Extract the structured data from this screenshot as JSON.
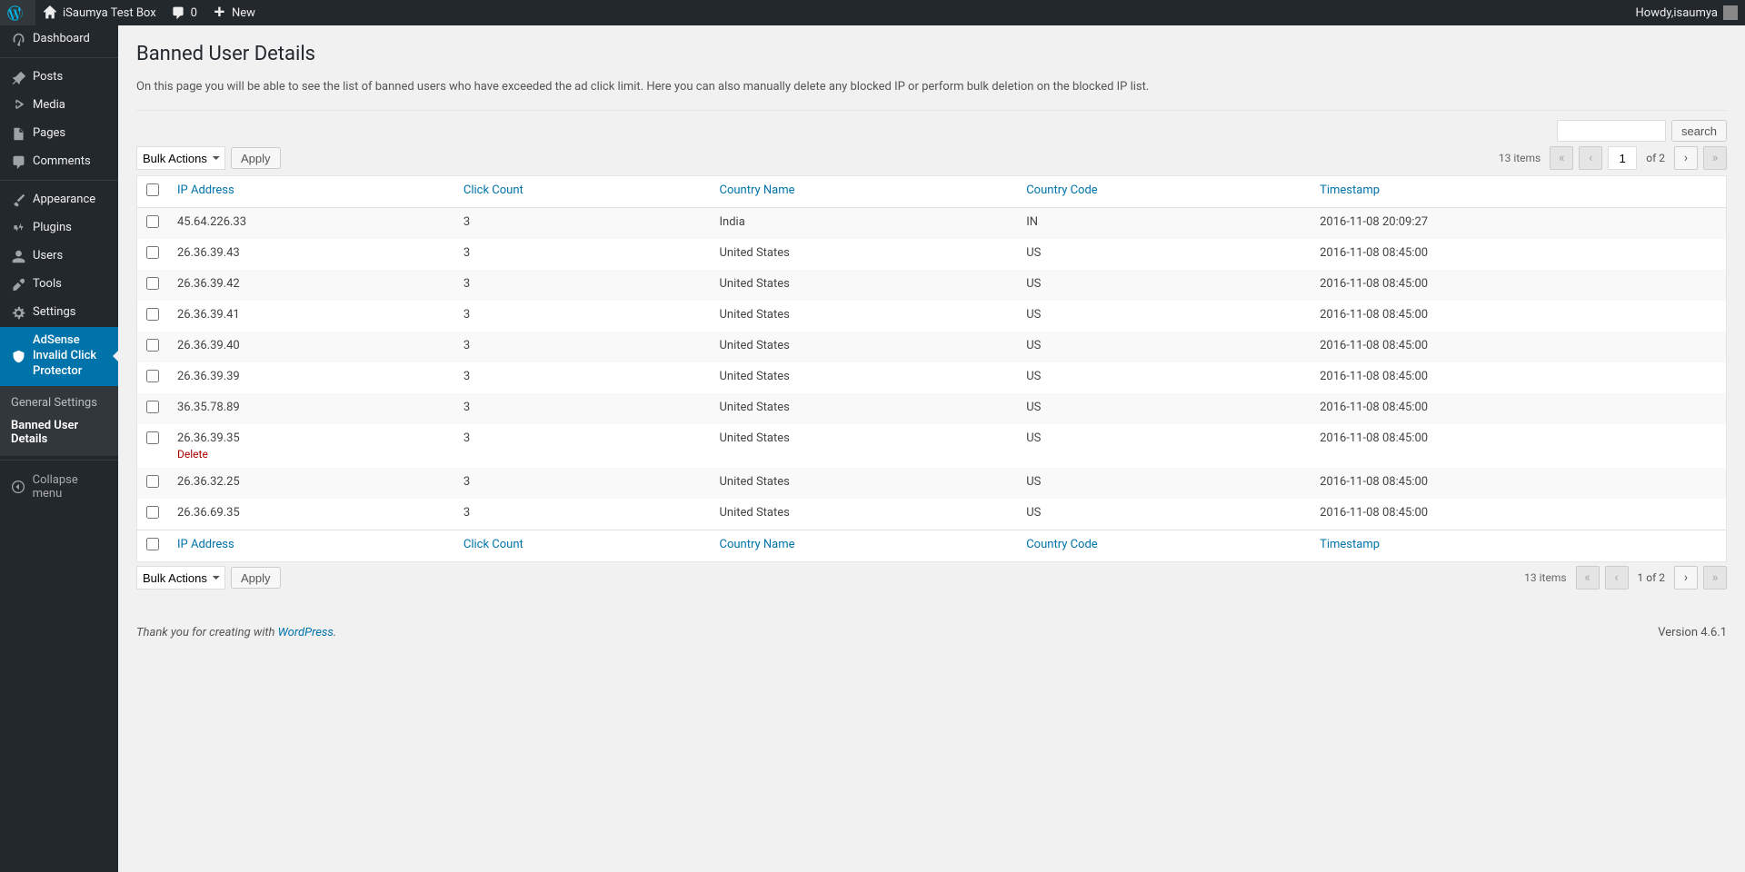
{
  "adminbar": {
    "site_name": "iSaumya Test Box",
    "comments": "0",
    "new_label": "New",
    "howdy_prefix": "Howdy, ",
    "username": "isaumya"
  },
  "sidebar": {
    "items": [
      {
        "icon": "dash",
        "label": "Dashboard"
      },
      {
        "icon": "pin",
        "label": "Posts"
      },
      {
        "icon": "media",
        "label": "Media"
      },
      {
        "icon": "page",
        "label": "Pages"
      },
      {
        "icon": "comment",
        "label": "Comments"
      },
      {
        "icon": "brush",
        "label": "Appearance"
      },
      {
        "icon": "plug",
        "label": "Plugins"
      },
      {
        "icon": "user",
        "label": "Users"
      },
      {
        "icon": "wrench",
        "label": "Tools"
      },
      {
        "icon": "gear",
        "label": "Settings"
      },
      {
        "icon": "shield",
        "label": "AdSense Invalid Click Protector"
      }
    ],
    "submenu": [
      {
        "label": "General Settings"
      },
      {
        "label": "Banned User Details"
      }
    ],
    "collapse_label": "Collapse menu"
  },
  "page": {
    "title": "Banned User Details",
    "description": "On this page you will be able to see the list of banned users who have exceeded the ad click limit. Here you can also manually delete any blocked IP or perform bulk deletion on the blocked IP list.",
    "search_label": "search",
    "bulk_actions_label": "Bulk Actions",
    "apply_label": "Apply",
    "items_count": "13 items",
    "page_current": "1",
    "page_of": "of 2",
    "page_combined": "1 of 2",
    "columns": {
      "ip": "IP Address",
      "click": "Click Count",
      "country_name": "Country Name",
      "country_code": "Country Code",
      "timestamp": "Timestamp"
    },
    "row_action_delete": "Delete"
  },
  "rows": [
    {
      "ip": "45.64.226.33",
      "click": "3",
      "country_name": "India",
      "country_code": "IN",
      "timestamp": "2016-11-08 20:09:27",
      "show_delete": false
    },
    {
      "ip": "26.36.39.43",
      "click": "3",
      "country_name": "United States",
      "country_code": "US",
      "timestamp": "2016-11-08 08:45:00",
      "show_delete": false
    },
    {
      "ip": "26.36.39.42",
      "click": "3",
      "country_name": "United States",
      "country_code": "US",
      "timestamp": "2016-11-08 08:45:00",
      "show_delete": false
    },
    {
      "ip": "26.36.39.41",
      "click": "3",
      "country_name": "United States",
      "country_code": "US",
      "timestamp": "2016-11-08 08:45:00",
      "show_delete": false
    },
    {
      "ip": "26.36.39.40",
      "click": "3",
      "country_name": "United States",
      "country_code": "US",
      "timestamp": "2016-11-08 08:45:00",
      "show_delete": false
    },
    {
      "ip": "26.36.39.39",
      "click": "3",
      "country_name": "United States",
      "country_code": "US",
      "timestamp": "2016-11-08 08:45:00",
      "show_delete": false
    },
    {
      "ip": "36.35.78.89",
      "click": "3",
      "country_name": "United States",
      "country_code": "US",
      "timestamp": "2016-11-08 08:45:00",
      "show_delete": false
    },
    {
      "ip": "26.36.39.35",
      "click": "3",
      "country_name": "United States",
      "country_code": "US",
      "timestamp": "2016-11-08 08:45:00",
      "show_delete": true
    },
    {
      "ip": "26.36.32.25",
      "click": "3",
      "country_name": "United States",
      "country_code": "US",
      "timestamp": "2016-11-08 08:45:00",
      "show_delete": false
    },
    {
      "ip": "26.36.69.35",
      "click": "3",
      "country_name": "United States",
      "country_code": "US",
      "timestamp": "2016-11-08 08:45:00",
      "show_delete": false
    }
  ],
  "footer": {
    "thanks_prefix": "Thank you for creating with ",
    "thanks_link": "WordPress",
    "thanks_suffix": ".",
    "version": "Version 4.6.1"
  },
  "pagination_symbols": {
    "first": "«",
    "prev": "‹",
    "next": "›",
    "last": "»"
  }
}
